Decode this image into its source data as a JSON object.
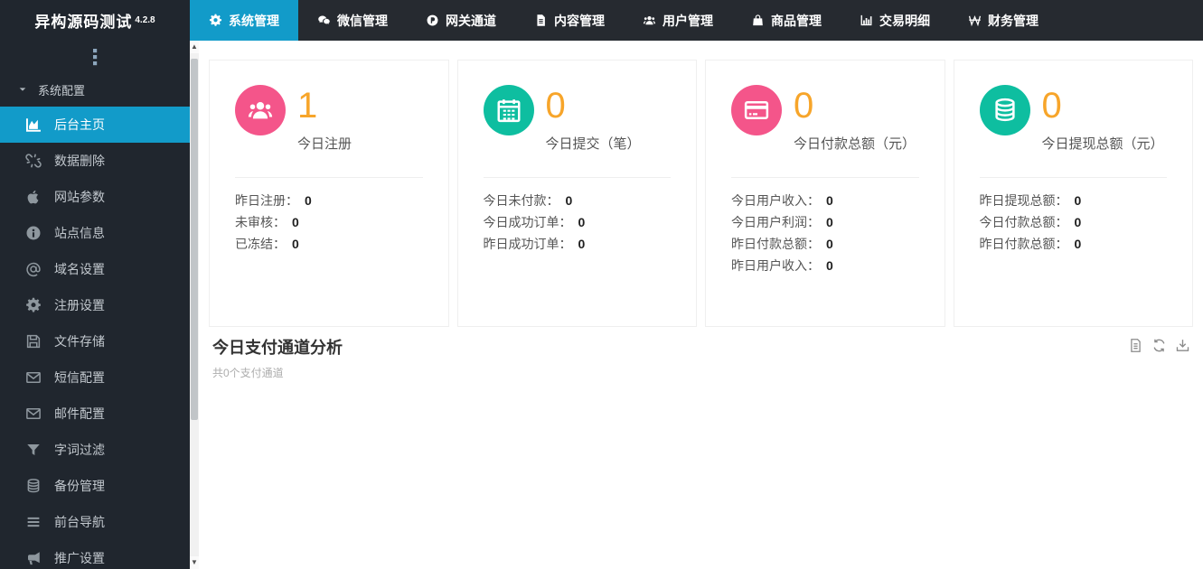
{
  "colors": {
    "accent": "#129BC9",
    "pink": "#F4558A",
    "teal": "#0EBEA0",
    "orange": "#F7A52A",
    "sidebar_bg": "#20262E",
    "topnav_bg": "#262A30"
  },
  "app": {
    "title": "异构源码测试",
    "version": "4.2.8"
  },
  "topnav": {
    "items": [
      {
        "name": "system",
        "label": "系统管理",
        "icon": "gear-icon",
        "active": true
      },
      {
        "name": "wechat",
        "label": "微信管理",
        "icon": "wechat-icon",
        "active": false
      },
      {
        "name": "gateway",
        "label": "网关通道",
        "icon": "p-circle-icon",
        "active": false
      },
      {
        "name": "content",
        "label": "内容管理",
        "icon": "file-icon",
        "active": false
      },
      {
        "name": "users",
        "label": "用户管理",
        "icon": "users-icon",
        "active": false
      },
      {
        "name": "goods",
        "label": "商品管理",
        "icon": "bag-icon",
        "active": false
      },
      {
        "name": "transactions",
        "label": "交易明细",
        "icon": "chart-bar-icon",
        "active": false
      },
      {
        "name": "finance",
        "label": "财务管理",
        "icon": "won-icon",
        "active": false
      }
    ]
  },
  "sidebar": {
    "section": {
      "label": "系统配置",
      "icon": "caret-down-icon"
    },
    "items": [
      {
        "name": "home",
        "label": "后台主页",
        "icon": "area-chart-icon",
        "active": true
      },
      {
        "name": "data-delete",
        "label": "数据删除",
        "icon": "chain-broken-icon",
        "active": false
      },
      {
        "name": "site-params",
        "label": "网站参数",
        "icon": "apple-icon",
        "active": false
      },
      {
        "name": "site-info",
        "label": "站点信息",
        "icon": "info-icon",
        "active": false
      },
      {
        "name": "domain",
        "label": "域名设置",
        "icon": "at-icon",
        "active": false
      },
      {
        "name": "register",
        "label": "注册设置",
        "icon": "gear-icon",
        "active": false
      },
      {
        "name": "file-storage",
        "label": "文件存储",
        "icon": "save-icon",
        "active": false
      },
      {
        "name": "sms",
        "label": "短信配置",
        "icon": "envelope-icon",
        "active": false
      },
      {
        "name": "mail",
        "label": "邮件配置",
        "icon": "envelope-icon",
        "active": false
      },
      {
        "name": "word-filter",
        "label": "字词过滤",
        "icon": "filter-icon",
        "active": false
      },
      {
        "name": "backup",
        "label": "备份管理",
        "icon": "database-icon",
        "active": false
      },
      {
        "name": "front-nav",
        "label": "前台导航",
        "icon": "bars-icon",
        "active": false
      },
      {
        "name": "promotion",
        "label": "推广设置",
        "icon": "bullhorn-icon",
        "active": false
      }
    ]
  },
  "cards": [
    {
      "name": "register-today",
      "icon": "users-icon",
      "icon_bg": "#F4558A",
      "value": "1",
      "label": "今日注册",
      "rows": [
        {
          "label": "昨日注册：",
          "value": "0"
        },
        {
          "label": "未审核：",
          "value": "0"
        },
        {
          "label": "已冻结：",
          "value": "0"
        }
      ]
    },
    {
      "name": "submit-today",
      "icon": "calendar-icon",
      "icon_bg": "#0EBEA0",
      "value": "0",
      "label": "今日提交（笔）",
      "rows": [
        {
          "label": "今日未付款：",
          "value": "0"
        },
        {
          "label": "今日成功订单：",
          "value": "0"
        },
        {
          "label": "昨日成功订单：",
          "value": "0"
        }
      ]
    },
    {
      "name": "payment-today",
      "icon": "credit-card-icon",
      "icon_bg": "#F4558A",
      "value": "0",
      "label": "今日付款总额（元）",
      "rows": [
        {
          "label": "今日用户收入：",
          "value": "0"
        },
        {
          "label": "今日用户利润：",
          "value": "0"
        },
        {
          "label": "昨日付款总额：",
          "value": "0"
        },
        {
          "label": "昨日用户收入：",
          "value": "0"
        }
      ]
    },
    {
      "name": "withdraw-today",
      "icon": "database-icon",
      "icon_bg": "#0EBEA0",
      "value": "0",
      "label": "今日提现总额（元）",
      "rows": [
        {
          "label": "昨日提现总额：",
          "value": "0"
        },
        {
          "label": "今日付款总额：",
          "value": "0"
        },
        {
          "label": "昨日付款总额：",
          "value": "0"
        }
      ]
    }
  ],
  "panel": {
    "title": "今日支付通道分析",
    "subtitle": "共0个支付通道",
    "tools": [
      {
        "name": "data-view",
        "icon": "file-lines-icon"
      },
      {
        "name": "refresh",
        "icon": "refresh-icon"
      },
      {
        "name": "download",
        "icon": "download-icon"
      }
    ]
  }
}
